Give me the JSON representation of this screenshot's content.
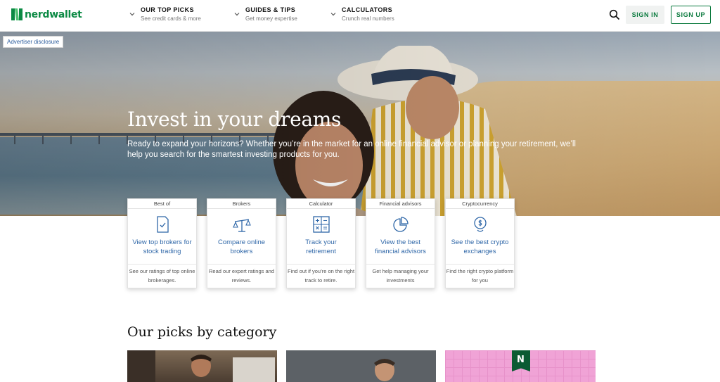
{
  "brand": {
    "logo_text": "nerdwallet",
    "accent": "#0b8a44",
    "link_color": "#2f67a8"
  },
  "nav": {
    "menus": [
      {
        "title": "OUR TOP PICKS",
        "subtitle": "See credit cards & more"
      },
      {
        "title": "GUIDES & TIPS",
        "subtitle": "Get money expertise"
      },
      {
        "title": "CALCULATORS",
        "subtitle": "Crunch real numbers"
      }
    ],
    "search_icon": "search-icon",
    "sign_in": "SIGN IN",
    "sign_up": "SIGN UP"
  },
  "hero": {
    "disclosure": "Advertiser disclosure",
    "title": "Invest in your dreams",
    "description": "Ready to expand your horizons? Whether you’re in the market for an online financial advisor or planning your retirement, we’ll help you search for the smartest investing products for you."
  },
  "cards": [
    {
      "category": "Best of",
      "icon": "document-check-icon",
      "link": "View top brokers for stock trading",
      "footer": "See our ratings of top online brokerages."
    },
    {
      "category": "Brokers",
      "icon": "scale-icon",
      "link": "Compare online brokers",
      "footer": "Read our expert ratings and reviews."
    },
    {
      "category": "Calculator",
      "icon": "calculator-icon",
      "link": "Track your retirement",
      "footer": "Find out if you’re on the right track to retire."
    },
    {
      "category": "Financial advisors",
      "icon": "pie-chart-icon",
      "link": "View the best financial advisors",
      "footer": "Get help managing your investments"
    },
    {
      "category": "Cryptocurrency",
      "icon": "crypto-coin-icon",
      "link": "See the best crypto exchanges",
      "footer": "Find the right crypto platform for you"
    }
  ],
  "picks": {
    "title": "Our picks by category",
    "badge_letter": "N"
  }
}
